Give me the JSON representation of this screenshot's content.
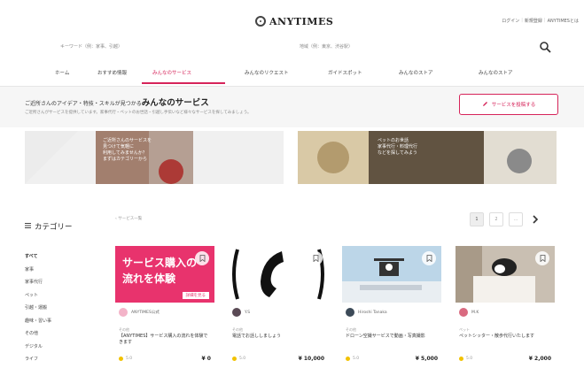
{
  "header": {
    "logo_text": "ANYTIMES",
    "top_links": [
      "ログイン",
      "新規登録",
      "ANYTIMESとは"
    ],
    "search_placeholder": "キーワード（例：家事、引越）",
    "area_placeholder": "地域（例：東京、渋谷駅）"
  },
  "nav": {
    "items": [
      "ホーム",
      "おすすめ情報",
      "みんなのサービス",
      "みんなのリクエスト",
      "ガイドスポット",
      "みんなのストア",
      "みんなのストア"
    ]
  },
  "band": {
    "title_prefix": "ご近所さんのアイデア・特技・スキルが見つかる",
    "title_main": "みんなのサービス",
    "subtitle": "ご近所さんがサービスを提供しています。家事代行・ペットのお世話・引越し手伝いなど様々なサービスを探してみましょう。",
    "post_button": "サービスを投稿する"
  },
  "banners": {
    "left_text": [
      "ご近所さんのサービスを",
      "見つけて気軽に",
      "利用してみませんか？",
      "まずはカテゴリーから"
    ],
    "right_text": [
      "ペットのお世話",
      "家事代行・料理代行",
      "などを探してみよう"
    ]
  },
  "sidebar": {
    "title": "カテゴリー",
    "items": [
      {
        "label": "すべて",
        "head": true
      },
      {
        "label": "家事",
        "head": false
      },
      {
        "label": "家事代行",
        "head": false
      },
      {
        "label": "ペット",
        "head": false
      },
      {
        "label": "引越・運搬",
        "head": false
      },
      {
        "label": "趣味・習い事",
        "head": false
      },
      {
        "label": "その他",
        "head": false
      },
      {
        "label": "デジタル",
        "head": false
      },
      {
        "label": "ライフ",
        "head": false
      }
    ]
  },
  "content": {
    "breadcrumb": "‹ サービス一覧",
    "pager": [
      "1",
      "2",
      "…"
    ]
  },
  "cards": [
    {
      "img_text": [
        "サービス購入の",
        "流れを体験"
      ],
      "img_tag": "詳細を見る",
      "user": "ANYTIMES公式",
      "category": "その他",
      "title": "【ANYTIMES】サービス購入の流れを体験できます",
      "rating": "5.0",
      "price": "¥ 0"
    },
    {
      "user": "Y.S",
      "category": "その他",
      "title": "電話でお話ししましょう",
      "rating": "5.0",
      "price": "¥ 10,000"
    },
    {
      "user": "Hiroshi Tanaka",
      "category": "その他",
      "title": "ドローン空撮サービスで動画・写真撮影",
      "rating": "5.0",
      "price": "¥ 5,000"
    },
    {
      "user": "M.K",
      "category": "ペット",
      "title": "ペットシッター・散歩代行いたします",
      "rating": "5.0",
      "price": "¥ 2,000"
    }
  ],
  "colors": {
    "accent": "#d6245a",
    "card1_bg": "#e8336d"
  }
}
